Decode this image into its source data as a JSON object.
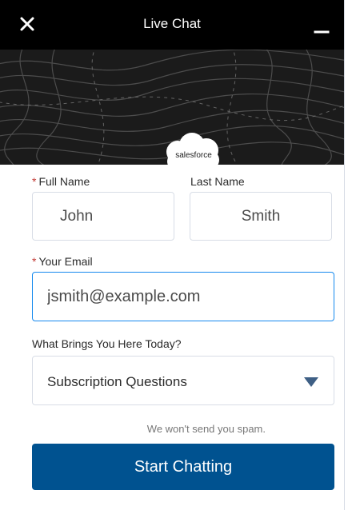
{
  "header": {
    "title": "Live Chat",
    "close_icon": "close-icon",
    "minimize_icon": "minimize-icon"
  },
  "banner": {
    "logo_text": "salesforce"
  },
  "form": {
    "first_name": {
      "label": "Full Name",
      "required": "*",
      "value": "John"
    },
    "last_name": {
      "label": "Last Name",
      "value": "Smith"
    },
    "email": {
      "label": "Your Email",
      "required": "*",
      "value": "jsmith@example.com"
    },
    "reason": {
      "label": "What Brings You Here Today?",
      "selected": "Subscription Questions"
    }
  },
  "note": "We won't send you spam.",
  "submit_label": "Start Chatting",
  "colors": {
    "header_bg": "#000000",
    "banner_bg": "#1b1b1b",
    "logo_blue": "#00a1e0",
    "required_red": "#c23934",
    "focus_blue": "#1589ee",
    "button_blue": "#005290",
    "arrow_blue": "#3e5f85"
  }
}
